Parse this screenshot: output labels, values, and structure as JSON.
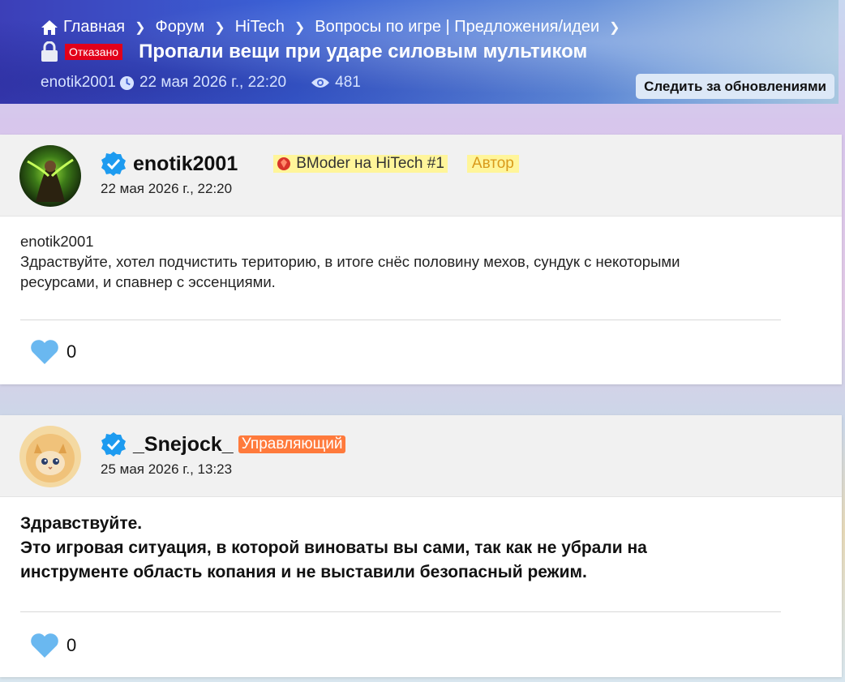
{
  "breadcrumb": {
    "items": [
      "Главная",
      "Форум",
      "HiTech",
      "Вопросы по игре | Предложения/идеи"
    ]
  },
  "thread": {
    "status": "Отказано",
    "title": "Пропали вещи при ударе силовым мультиком",
    "author": "enotik2001",
    "date": "22 мая 2026 г., 22:20",
    "views": "481",
    "follow_label": "Следить за обновлениями"
  },
  "posts": [
    {
      "username": "enotik2001",
      "badges": {
        "rank": "BModer на HiTech #1",
        "role": "Автор"
      },
      "date": "22 мая 2026 г., 22:20",
      "body_lines": [
        "enotik2001",
        "Здраствуйте, хотел подчистить територию, в итоге снёс половину мехов, сундук с некоторыми",
        "ресурсами, и спавнер с эссенциями."
      ],
      "likes": "0"
    },
    {
      "username": "_Snejock_",
      "badges": {
        "role": "Управляющий"
      },
      "date": "25 мая 2026 г., 13:23",
      "body_lines": [
        "Здравствуйте.",
        "Это игровая ситуация, в которой виноваты вы сами, так как не убрали на",
        "инструменте область копания и не выставили безопасный режим."
      ],
      "likes": "0"
    }
  ],
  "colors": {
    "status_badge": "#e2001a",
    "manager_badge": "#ff7a3c",
    "author_badge_bg": "#fff59a",
    "heart": "#6ab8f0",
    "verified": "#1d9bf0"
  },
  "icons": [
    "home-icon",
    "chevron-right-icon",
    "lock-icon",
    "clock-icon",
    "eye-icon",
    "verified-icon",
    "gem-icon",
    "heart-icon"
  ]
}
